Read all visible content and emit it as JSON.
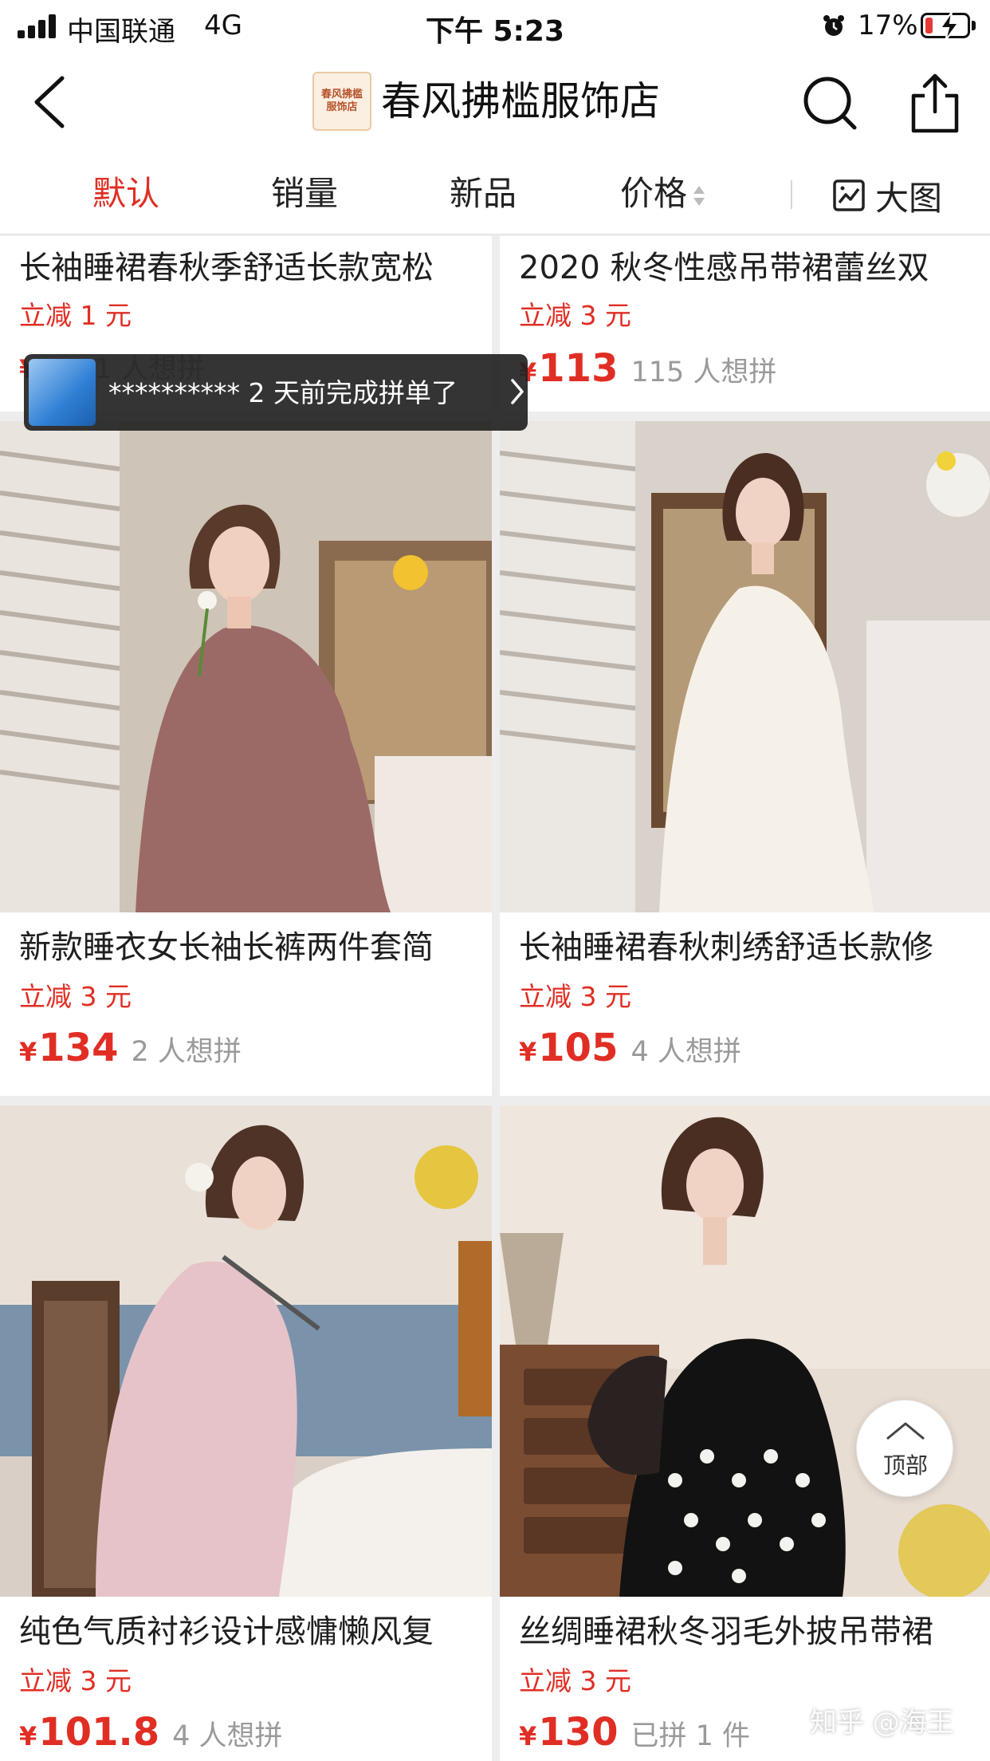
{
  "status_bar": {
    "carrier": "中国联通",
    "network": "4G",
    "time": "下午 5:23",
    "battery": "17%",
    "battery_level": 0.17
  },
  "header": {
    "shop_logo_text": "春风拂槛服饰店",
    "shop_name": "春风拂槛服饰店"
  },
  "tabs": [
    {
      "label": "默认",
      "active": true
    },
    {
      "label": "销量",
      "active": false
    },
    {
      "label": "新品",
      "active": false
    },
    {
      "label": "价格",
      "active": false
    }
  ],
  "view_toggle": {
    "label": "大图"
  },
  "toast": {
    "text": "********** 2 天前完成拼单了"
  },
  "products": [
    {
      "title": "长袖睡裙春秋季舒适长款宽松",
      "discount": "立减 1 元",
      "yen": "¥",
      "price": "",
      "sold": "1 人想拼"
    },
    {
      "title": "2020 秋冬性感吊带裙蕾丝双",
      "discount": "立减 3 元",
      "yen": "¥",
      "price": "113",
      "sold": "115 人想拼"
    },
    {
      "title": "新款睡衣女长袖长裤两件套简",
      "discount": "立减 3 元",
      "yen": "¥",
      "price": "134",
      "sold": "2 人想拼"
    },
    {
      "title": "长袖睡裙春秋刺绣舒适长款修",
      "discount": "立减 3 元",
      "yen": "¥",
      "price": "105",
      "sold": "4 人想拼"
    },
    {
      "title": "纯色气质衬衫设计感慵懒风复",
      "discount": "立减 3 元",
      "yen": "¥",
      "price": "101.8",
      "sold": "4 人想拼"
    },
    {
      "title": "丝绸睡裙秋冬羽毛外披吊带裙",
      "discount": "立减 3 元",
      "yen": "¥",
      "price": "130",
      "sold": "已拼 1 件"
    }
  ],
  "back_to_top": {
    "label": "顶部"
  },
  "watermark": "知乎 @海王",
  "colors": {
    "accent": "#e02e24",
    "muted": "#9a9a9a",
    "background": "#ededed"
  }
}
